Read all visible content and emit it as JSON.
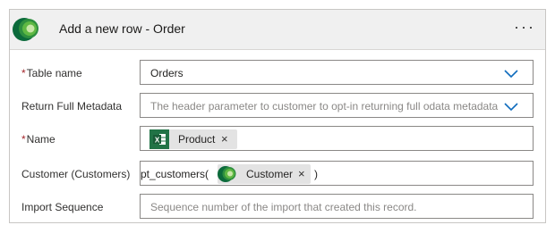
{
  "header": {
    "title": "Add a new row - Order",
    "more_icon": "···"
  },
  "colors": {
    "required_star": "#a4262c",
    "dataverse_green_dark": "#0b6a3b",
    "dataverse_green_light": "#5fb843",
    "excel_green": "#217346",
    "token_bg": "#e3e3e3"
  },
  "fields": {
    "table_name": {
      "required_mark": "*",
      "label": "Table name",
      "value": "Orders"
    },
    "return_metadata": {
      "label": "Return Full Metadata",
      "placeholder": "The header parameter to customer to opt-in returning full odata metadata"
    },
    "name": {
      "required_mark": "*",
      "label": "Name",
      "token": {
        "label": "Product",
        "close": "×",
        "icon": "excel-icon"
      }
    },
    "customer": {
      "label": "Customer (Customers)",
      "prefix": "pt_customers(",
      "suffix": ")",
      "token": {
        "label": "Customer",
        "close": "×",
        "icon": "dataverse-icon"
      }
    },
    "import_sequence": {
      "label": "Import Sequence",
      "placeholder": "Sequence number of the import that created this record."
    }
  }
}
